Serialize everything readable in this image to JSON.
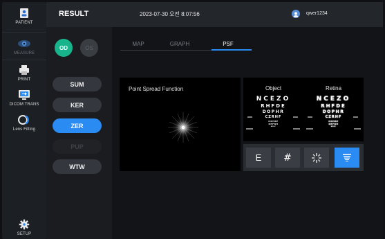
{
  "sidebar": {
    "items": [
      {
        "label": "PATIENT",
        "icon": "patient-card-icon"
      },
      {
        "label": "MEASURE",
        "icon": "eye-icon"
      },
      {
        "label": "PRINT",
        "icon": "printer-icon"
      },
      {
        "label": "DICOM TRANS",
        "icon": "monitor-transfer-icon"
      },
      {
        "label": "Lens Fitting",
        "icon": "lens-icon"
      },
      {
        "label": "SETUP",
        "icon": "gear-icon"
      }
    ]
  },
  "header": {
    "title": "RESULT",
    "datetime": "2023-07-30 오전 8:07:56",
    "username": "qwer1234"
  },
  "eye_toggle": {
    "od": "OD",
    "os": "OS",
    "selected": "OD"
  },
  "modes": [
    {
      "label": "SUM",
      "state": "normal"
    },
    {
      "label": "KER",
      "state": "normal"
    },
    {
      "label": "ZER",
      "state": "active"
    },
    {
      "label": "PUP",
      "state": "disabled"
    },
    {
      "label": "WTW",
      "state": "normal"
    }
  ],
  "tabs": [
    {
      "label": "MAP",
      "active": false
    },
    {
      "label": "GRAPH",
      "active": false
    },
    {
      "label": "PSF",
      "active": true
    }
  ],
  "psf": {
    "title": "Point Spread Function"
  },
  "simulation": {
    "object_label": "Object",
    "retina_label": "Retina",
    "chart_rows": [
      "NCEZO",
      "RHFDE",
      "DOPHR",
      "CZRHF",
      "ONHRE",
      "DEFNH",
      "NORC"
    ]
  },
  "view_buttons": [
    {
      "name": "letter-e-view",
      "label": "E",
      "active": false
    },
    {
      "name": "grid-view",
      "label": "#",
      "active": false
    },
    {
      "name": "spoke-view",
      "label": "",
      "active": false
    },
    {
      "name": "chart-view",
      "label": "",
      "active": true
    }
  ],
  "colors": {
    "accent": "#2a8bf2",
    "od_green": "#18b58c"
  }
}
